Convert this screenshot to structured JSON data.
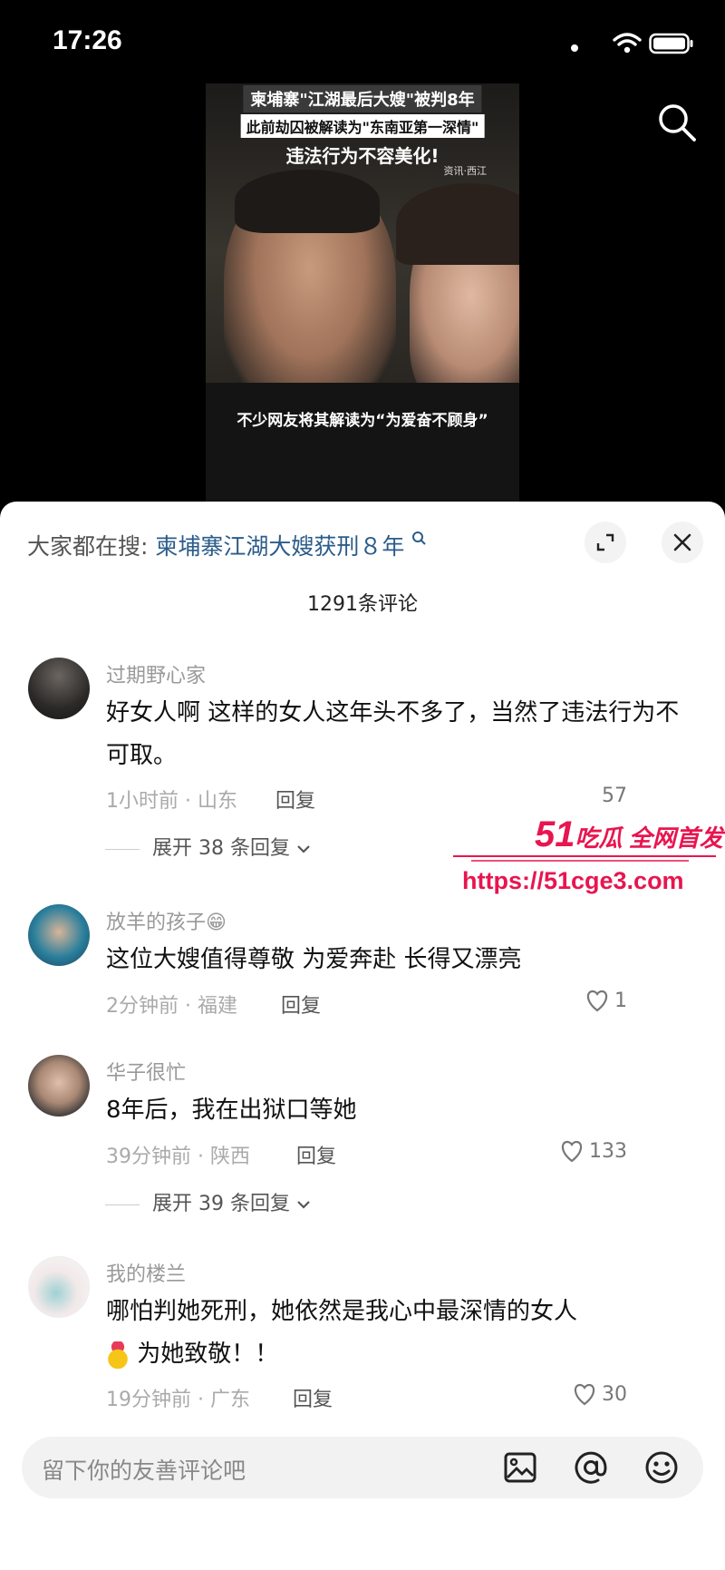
{
  "status_bar": {
    "time": "17:26"
  },
  "video": {
    "title_line1": "柬埔寨\"江湖最后大嫂\"被判8年",
    "title_line2": "此前劫囚被解读为\"东南亚第一深情\"",
    "title_line3": "违法行为不容美化!",
    "watermark": "资讯·西江",
    "subtitle": "不少网友将其解读为“为爱奋不顾身”"
  },
  "sheet": {
    "hot_search_label": "大家都在搜:",
    "hot_search_keyword": "柬埔寨江湖大嫂获刑８年",
    "comment_count": "1291条评论"
  },
  "comments": [
    {
      "name": "过期野心家",
      "text": "好女人啊 这样的女人这年头不多了，当然了违法行为不可取。",
      "meta": "1小时前 · 山东",
      "reply": "回复",
      "likes": "57",
      "expand": "展开 38 条回复"
    },
    {
      "name": "放羊的孩子😁",
      "text": "这位大嫂值得尊敬 为爱奔赴 长得又漂亮",
      "meta": "2分钟前 · 福建",
      "reply": "回复",
      "likes": "1"
    },
    {
      "name": "华子很忙",
      "text": "8年后，我在出狱口等她",
      "meta": "39分钟前 · 陕西",
      "reply": "回复",
      "likes": "133",
      "expand": "展开 39 条回复"
    },
    {
      "name": "我的楼兰",
      "text": "哪怕判她死刑，她依然是我心中最深情的女人",
      "text2": "为她致敬！！",
      "meta": "19分钟前 · 广东",
      "reply": "回复",
      "likes": "30"
    }
  ],
  "promo": {
    "brand_num": "51",
    "brand_text": "吃瓜 全网首发",
    "url": "https://51cge3.com"
  },
  "input": {
    "placeholder": "留下你的友善评论吧"
  },
  "icons": [
    "search-icon",
    "expand-icon",
    "close-icon",
    "image-icon",
    "at-icon",
    "emoji-icon",
    "heart-icon",
    "chevron-down-icon"
  ]
}
